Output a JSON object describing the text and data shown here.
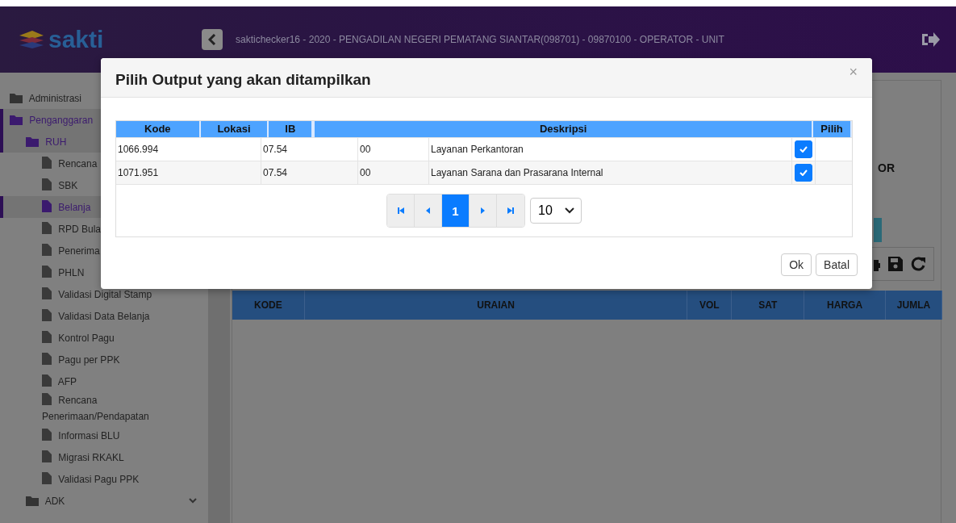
{
  "header": {
    "logo": "sakti",
    "title": "saktichecker16 - 2020 - PENGADILAN NEGERI PEMATANG SIANTAR(098701) - 09870100 - OPERATOR - UNIT"
  },
  "sidebar": {
    "items": [
      {
        "label": "Administrasi",
        "kind": "folder",
        "selected": false,
        "chevron": false
      },
      {
        "label": "Penganggaran",
        "kind": "folder",
        "selected": true,
        "chevron": false,
        "children": [
          {
            "label": "RUH",
            "kind": "folder",
            "selected": true,
            "chevron": false,
            "children": [
              {
                "label": "Rencana",
                "kind": "file",
                "selected": false,
                "chevron": false
              },
              {
                "label": "SBK",
                "kind": "file",
                "selected": false,
                "chevron": false
              },
              {
                "label": "Belanja",
                "kind": "file",
                "selected": true,
                "chevron": false
              },
              {
                "label": "RPD Bula",
                "kind": "file",
                "selected": false,
                "chevron": false
              },
              {
                "label": "Penerima",
                "kind": "file",
                "selected": false,
                "chevron": false
              },
              {
                "label": "PHLN",
                "kind": "file",
                "selected": false,
                "chevron": false
              },
              {
                "label": "Validasi Digital Stamp",
                "kind": "file",
                "selected": false,
                "chevron": false
              },
              {
                "label": "Validasi Data Belanja",
                "kind": "file",
                "selected": false,
                "chevron": false
              },
              {
                "label": "Kontrol Pagu",
                "kind": "file",
                "selected": false,
                "chevron": false
              },
              {
                "label": "Pagu per PPK",
                "kind": "file",
                "selected": false,
                "chevron": false
              },
              {
                "label": "AFP",
                "kind": "file",
                "selected": false,
                "chevron": false
              },
              {
                "label": "Rencana Penerimaan/Pendapatan",
                "kind": "file",
                "selected": false,
                "chevron": false
              },
              {
                "label": "Informasi BLU",
                "kind": "file",
                "selected": false,
                "chevron": false
              },
              {
                "label": "Migrasi RKAKL",
                "kind": "file",
                "selected": false,
                "chevron": false
              },
              {
                "label": "Validasi Pagu PPK",
                "kind": "file",
                "selected": false,
                "chevron": false
              }
            ]
          },
          {
            "label": "ADK",
            "kind": "folder",
            "selected": false,
            "chevron": true
          }
        ]
      }
    ]
  },
  "background": {
    "fragment": "OR",
    "table": {
      "columns": [
        "KODE",
        "URAIAN",
        "VOL",
        "SAT",
        "HARGA",
        "JUMLA"
      ]
    }
  },
  "modal": {
    "title": "Pilih Output yang akan ditampilkan",
    "close": "×",
    "table": {
      "columns": [
        "Kode",
        "Lokasi",
        "IB",
        "",
        "Deskripsi",
        "Pilih"
      ],
      "rows": [
        {
          "cells": [
            "1066.994",
            "07.54",
            "00",
            "Layanan Perkantoran"
          ],
          "checked": true
        },
        {
          "cells": [
            "1071.951",
            "07.54",
            "00",
            "Layanan Sarana dan Prasarana Internal"
          ],
          "checked": true
        }
      ]
    },
    "pagination": {
      "pages": [
        {
          "label": "1",
          "selected": true
        }
      ],
      "page_size": "10"
    },
    "buttons": [
      "Ok",
      "Batal"
    ]
  }
}
